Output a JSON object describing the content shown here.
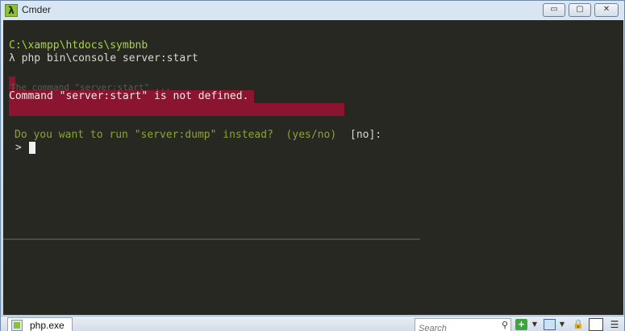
{
  "window": {
    "title": "Cmder",
    "minimize": "▭",
    "maximize": "▢",
    "close": "✕"
  },
  "console": {
    "path_line": "C:\\xampp\\htdocs\\symbnb",
    "command_line": "λ php bin\\console server:start",
    "ghost_text": "The command \"server:start\" ...",
    "error_message": "Command \"server:start\" is not defined.",
    "question": "Do you want to run \"server:dump\" instead?  (yes/no)",
    "default_answer": "[no]:",
    "prompt_symbol": ">"
  },
  "statusbar": {
    "tab_label": "php.exe",
    "search_placeholder": "Search",
    "search_icon": "search-icon",
    "lock_glyph": "🔒",
    "menu_glyph": "☰"
  },
  "colors": {
    "console_bg": "#272822",
    "path_green": "#a6d63e",
    "error_bg": "#8b1530",
    "question_green": "#8aa332"
  }
}
